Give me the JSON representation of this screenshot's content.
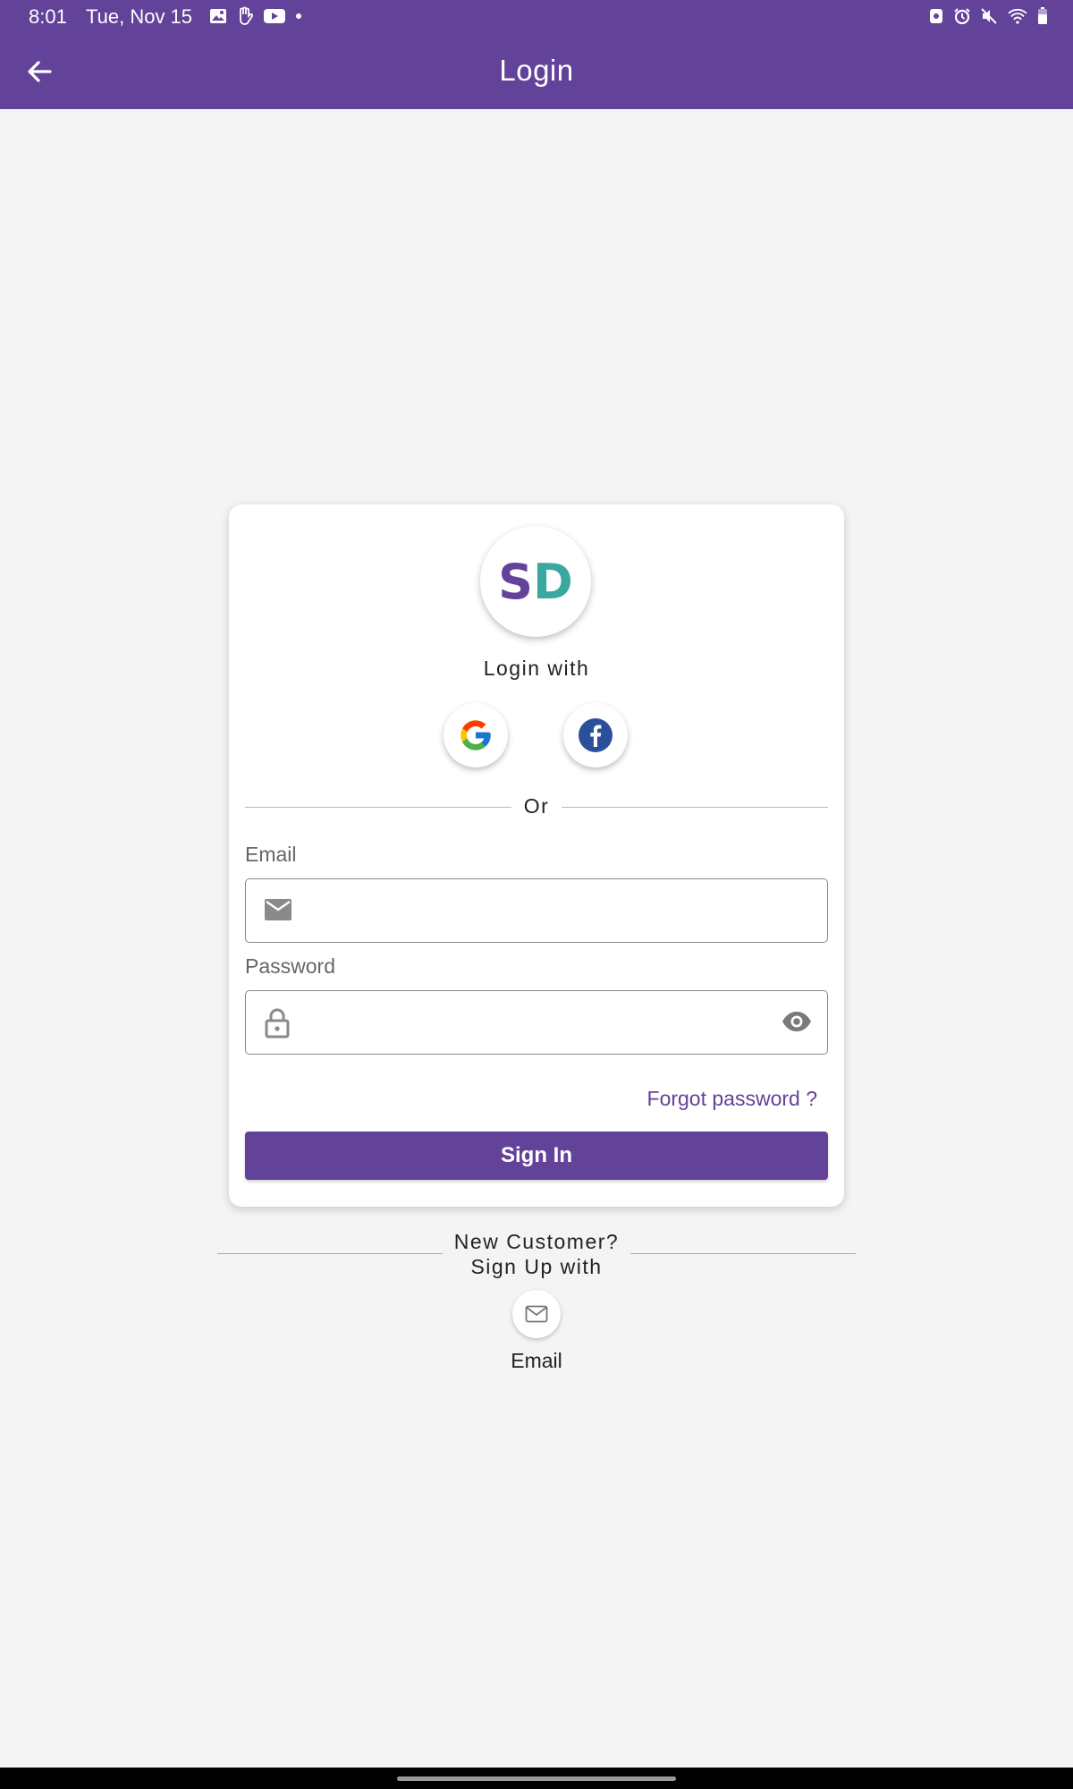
{
  "status_bar": {
    "time": "8:01",
    "date": "Tue, Nov 15",
    "left_icons": [
      "image-icon",
      "hand-icon",
      "youtube-icon",
      "dot-icon"
    ],
    "right_icons": [
      "battery-saver-icon",
      "alarm-icon",
      "mute-icon",
      "wifi-icon",
      "battery-icon"
    ]
  },
  "app_bar": {
    "title": "Login",
    "back_icon": "arrow-back-icon",
    "color": "#63429a"
  },
  "logo": {
    "letter1": "S",
    "letter2": "D",
    "color1": "#63429a",
    "color2": "#3aa8a0"
  },
  "login_card": {
    "login_with": "Login with",
    "social": [
      {
        "name": "google",
        "icon": "google-icon"
      },
      {
        "name": "facebook",
        "icon": "facebook-icon"
      }
    ],
    "divider_text": "Or",
    "email": {
      "label": "Email",
      "value": "",
      "icon": "mail-icon"
    },
    "password": {
      "label": "Password",
      "value": "",
      "icon": "lock-icon",
      "toggle_icon": "eye-icon"
    },
    "forgot_password": "Forgot password ?",
    "sign_in": "Sign In"
  },
  "signup": {
    "line1": "New Customer?",
    "line2": "Sign Up with",
    "email_icon": "mail-outline-icon",
    "email_label": "Email"
  }
}
